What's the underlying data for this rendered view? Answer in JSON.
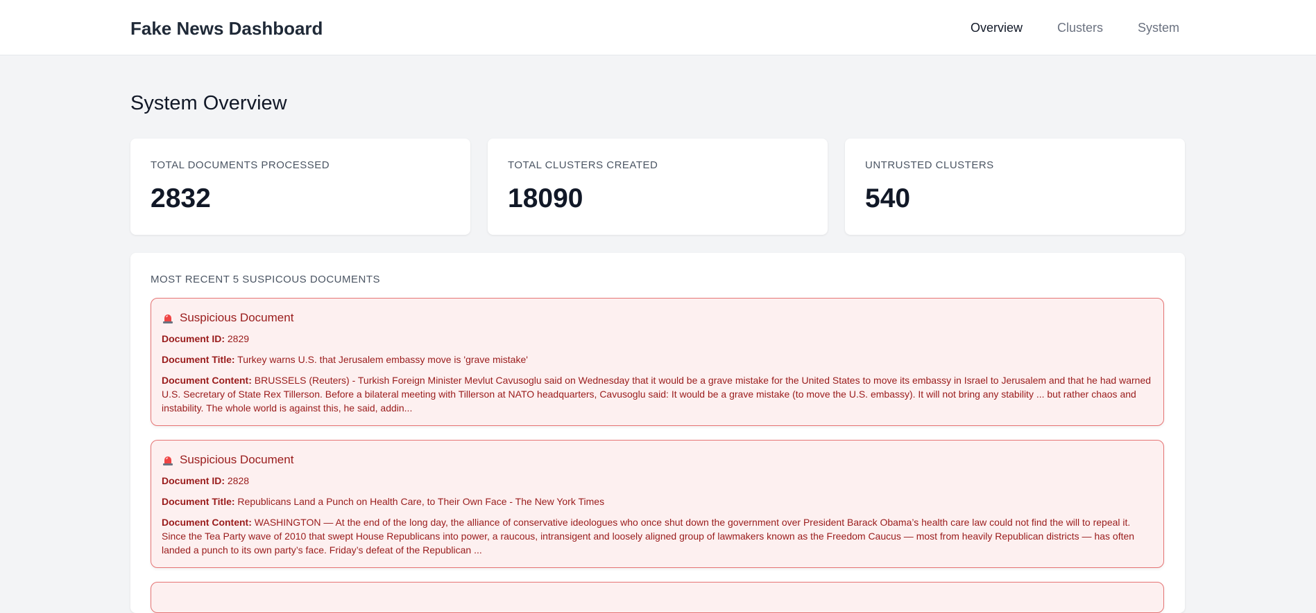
{
  "header": {
    "brand": "Fake News Dashboard",
    "nav": [
      {
        "label": "Overview",
        "active": true
      },
      {
        "label": "Clusters",
        "active": false
      },
      {
        "label": "System",
        "active": false
      }
    ]
  },
  "page": {
    "title": "System Overview"
  },
  "stats": [
    {
      "label": "TOTAL DOCUMENTS PROCESSED",
      "value": "2832"
    },
    {
      "label": "TOTAL CLUSTERS CREATED",
      "value": "18090"
    },
    {
      "label": "UNTRUSTED CLUSTERS",
      "value": "540"
    }
  ],
  "recent": {
    "title": "MOST RECENT 5 SUSPICOUS DOCUMENTS",
    "labels": {
      "heading": "Suspicious Document",
      "id": "Document ID:",
      "doc_title": "Document Title:",
      "content": "Document Content:"
    },
    "documents": [
      {
        "id": "2829",
        "title": "Turkey warns U.S. that Jerusalem embassy move is 'grave mistake'",
        "content": "BRUSSELS (Reuters) - Turkish Foreign Minister Mevlut Cavusoglu said on Wednesday that it would be a grave mistake for the United States to move its embassy in Israel to Jerusalem and that he had warned U.S. Secretary of State Rex Tillerson. Before a bilateral meeting with Tillerson at NATO headquarters, Cavusoglu said: It would be a grave mistake (to move the U.S. embassy). It will not bring any stability ... but rather chaos and instability. The whole world is against this, he said, addin..."
      },
      {
        "id": "2828",
        "title": "Republicans Land a Punch on Health Care, to Their Own Face - The New York Times",
        "content": "WASHINGTON — At the end of the long day, the alliance of conservative ideologues who once shut down the government over President Barack Obama’s health care law could not find the will to repeal it. Since the Tea Party wave of 2010 that swept House Republicans into power, a raucous, intransigent and loosely aligned group of lawmakers known as the Freedom Caucus — most from heavily Republican districts — has often landed a punch to its own party’s face. Friday’s defeat of the Republican ..."
      },
      {
        "id": "",
        "title": "",
        "content": ""
      }
    ]
  },
  "colors": {
    "alert_bg": "#fdf0f0",
    "alert_border": "#e57373",
    "alert_text": "#991b1b"
  }
}
